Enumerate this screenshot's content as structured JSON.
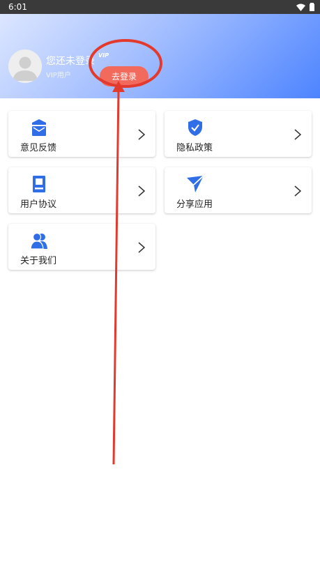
{
  "status_bar": {
    "time": "6:01"
  },
  "profile": {
    "name": "您还未登录",
    "vip_label": "VIP用户",
    "badge": "VIP",
    "login_button": "去登录"
  },
  "menu": {
    "items": [
      {
        "label": "意见反馈",
        "icon": "feedback-icon"
      },
      {
        "label": "隐私政策",
        "icon": "shield-check-icon"
      },
      {
        "label": "用户协议",
        "icon": "agreement-book-icon"
      },
      {
        "label": "分享应用",
        "icon": "share-plane-icon"
      },
      {
        "label": "关于我们",
        "icon": "people-icon"
      }
    ]
  },
  "colors": {
    "accent": "#2f6ee6",
    "login_button": "#f26a5c",
    "annotation_red": "#e23b2e"
  }
}
